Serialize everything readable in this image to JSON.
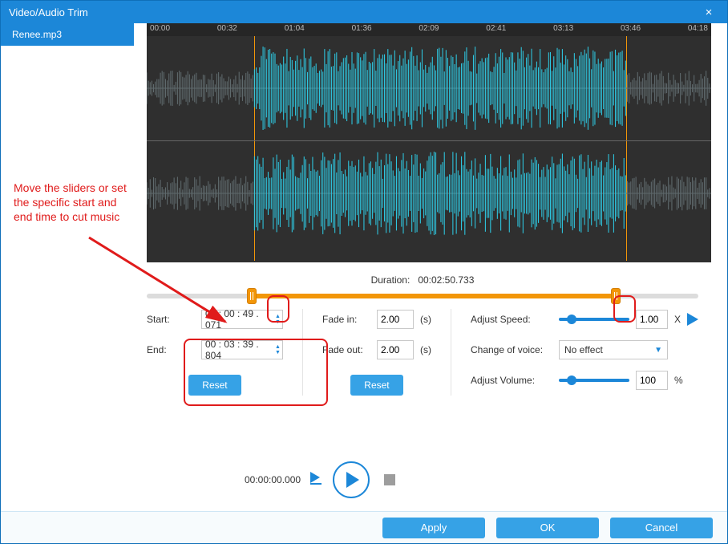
{
  "window": {
    "title": "Video/Audio Trim"
  },
  "file": {
    "name": "Renee.mp3"
  },
  "ruler": [
    "00:00",
    "00:32",
    "01:04",
    "01:36",
    "02:09",
    "02:41",
    "03:13",
    "03:46",
    "04:18"
  ],
  "duration": {
    "label": "Duration:",
    "value": "00:02:50.733"
  },
  "trim": {
    "start_label": "Start:",
    "start_value": "00 : 00 : 49 . 071",
    "end_label": "End:",
    "end_value": "00 : 03 : 39 . 804",
    "reset": "Reset"
  },
  "fade": {
    "in_label": "Fade in:",
    "in_value": "2.00",
    "in_unit": "(s)",
    "out_label": "Fade out:",
    "out_value": "2.00",
    "out_unit": "(s)",
    "reset": "Reset"
  },
  "adjust": {
    "speed_label": "Adjust Speed:",
    "speed_value": "1.00",
    "speed_unit": "X",
    "voice_label": "Change of voice:",
    "voice_value": "No effect",
    "volume_label": "Adjust Volume:",
    "volume_value": "100",
    "volume_unit": "%"
  },
  "playback": {
    "timecode": "00:00:00.000"
  },
  "footer": {
    "apply": "Apply",
    "ok": "OK",
    "cancel": "Cancel"
  },
  "hint": "Move the sliders or set\nthe specific start and\nend time to cut music",
  "slider_pos": {
    "start_pct": 19,
    "end_pct": 85
  }
}
